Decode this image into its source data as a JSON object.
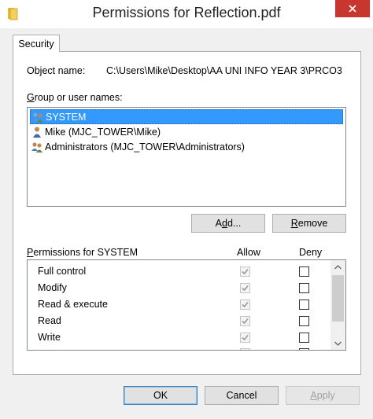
{
  "window": {
    "title": "Permissions for Reflection.pdf"
  },
  "tabs": [
    {
      "label": "Security"
    }
  ],
  "object_name": {
    "label": "Object name:",
    "value": "C:\\Users\\Mike\\Desktop\\AA UNI INFO YEAR 3\\PRCO3"
  },
  "groups": {
    "label_accel": "G",
    "label_rest": "roup or user names:",
    "items": [
      {
        "name": "SYSTEM",
        "selected": true,
        "icon": "group-users-icon"
      },
      {
        "name": "Mike (MJC_TOWER\\Mike)",
        "selected": false,
        "icon": "user-icon"
      },
      {
        "name": "Administrators (MJC_TOWER\\Administrators)",
        "selected": false,
        "icon": "group-users-icon"
      }
    ]
  },
  "buttons": {
    "add_pre": "A",
    "add_accel": "d",
    "add_post": "d...",
    "remove_accel": "R",
    "remove_post": "emove",
    "ok": "OK",
    "cancel": "Cancel",
    "apply_accel": "A",
    "apply_post": "pply"
  },
  "permissions": {
    "label_accel": "P",
    "label_rest": "ermissions for SYSTEM",
    "allow_header": "Allow",
    "deny_header": "Deny",
    "rows": [
      {
        "name": "Full control",
        "allow": true,
        "deny": false
      },
      {
        "name": "Modify",
        "allow": true,
        "deny": false
      },
      {
        "name": "Read & execute",
        "allow": true,
        "deny": false
      },
      {
        "name": "Read",
        "allow": true,
        "deny": false
      },
      {
        "name": "Write",
        "allow": true,
        "deny": false
      }
    ]
  },
  "colors": {
    "selection": "#3399ff",
    "close_button": "#c7372f"
  }
}
